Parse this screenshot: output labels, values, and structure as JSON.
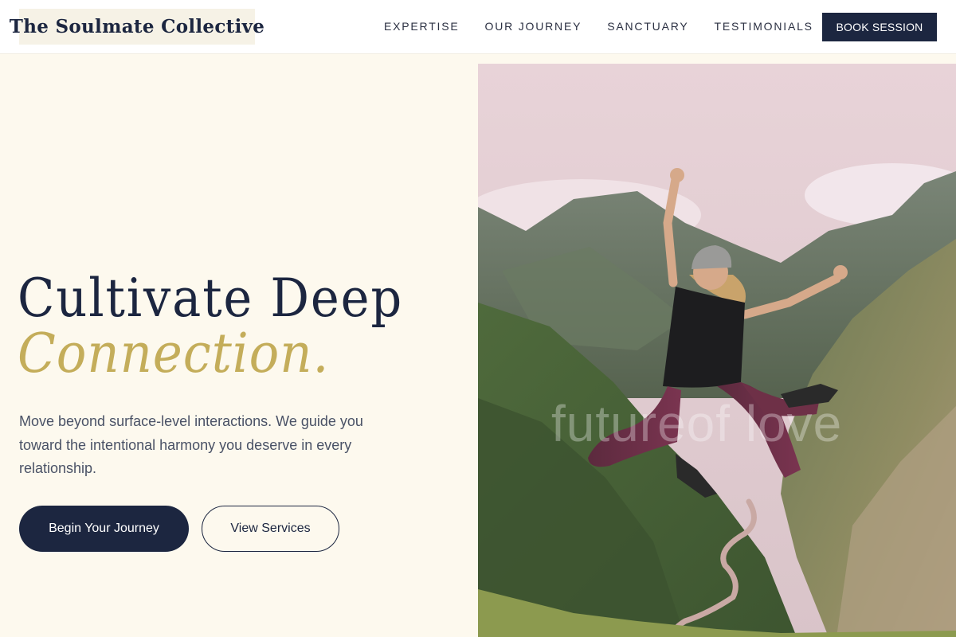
{
  "nav": {
    "logo": "The Soulmate Collective",
    "links": [
      "EXPERTISE",
      "OUR JOURNEY",
      "SANCTUARY",
      "TESTIMONIALS"
    ],
    "cta": "BOOK SESSION"
  },
  "hero": {
    "headline_line1": "Cultivate Deep",
    "headline_line2": "Connection.",
    "lede": "Move beyond surface-level interactions. We guide you toward the intentional harmony you deserve in every relationship.",
    "primary_cta": "Begin Your Journey",
    "secondary_cta": "View Services",
    "image_watermark": "futureof love"
  },
  "colors": {
    "navy": "#1c2640",
    "gold": "#c4ad5a",
    "cream": "#fdf9ee"
  }
}
